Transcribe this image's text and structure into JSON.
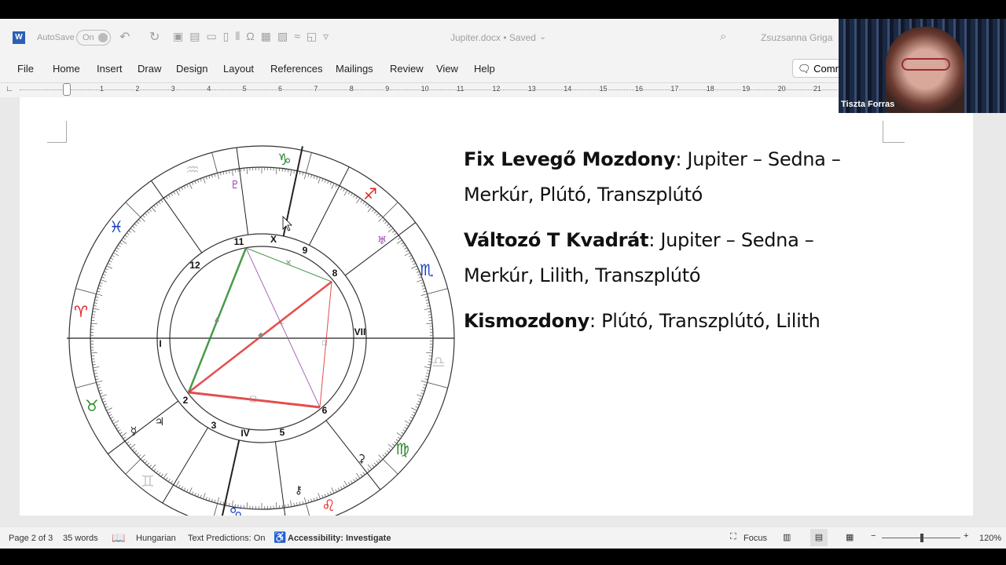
{
  "titlebar": {
    "autosave_label": "AutoSave",
    "autosave_state": "On",
    "document_title": "Jupiter.docx • Saved",
    "user_name": "Zsuzsanna Griga",
    "app_icon": "word-icon"
  },
  "ribbon": {
    "tabs": [
      "File",
      "Home",
      "Insert",
      "Draw",
      "Design",
      "Layout",
      "References",
      "Mailings",
      "Review",
      "View",
      "Help"
    ],
    "comments_label": "Comm"
  },
  "ruler": {
    "marks": [
      "1",
      "2",
      "3",
      "4",
      "5",
      "6",
      "7",
      "8",
      "9",
      "10",
      "11",
      "12",
      "13",
      "14",
      "15",
      "16",
      "17",
      "18",
      "19",
      "20",
      "21"
    ]
  },
  "document": {
    "paragraphs": [
      {
        "bold": "Fix Levegő Mozdony",
        "rest_line1": ": Jupiter – Sedna –",
        "line2": "Merkúr, Plútó, Transzplútó"
      },
      {
        "bold": "Változó T Kvadrát",
        "rest_line1": ": Jupiter – Sedna –",
        "line2": "Merkúr, Lilith, Transzplútó"
      },
      {
        "bold": "Kismozdony",
        "rest_line1": ": Plútó, Transzplútó, Lilith",
        "line2": ""
      }
    ],
    "chart": {
      "house_labels": [
        "11",
        "X",
        "9",
        "8",
        "12",
        "I",
        "VII",
        "2",
        "6",
        "3",
        "IV",
        "5"
      ],
      "zodiac_signs": [
        {
          "glyph": "♑",
          "color": "#2a8a2a"
        },
        {
          "glyph": "♒",
          "color": "#c8c8c8"
        },
        {
          "glyph": "♓",
          "color": "#1a3fbf"
        },
        {
          "glyph": "♈",
          "color": "#e02020"
        },
        {
          "glyph": "♉",
          "color": "#2a8a2a"
        },
        {
          "glyph": "♊",
          "color": "#c8c8c8"
        },
        {
          "glyph": "♋",
          "color": "#1a3fbf"
        },
        {
          "glyph": "♌",
          "color": "#e02020"
        },
        {
          "glyph": "♍",
          "color": "#2a8a2a"
        },
        {
          "glyph": "♎",
          "color": "#c8c8c8"
        },
        {
          "glyph": "♏",
          "color": "#1a3fbf"
        },
        {
          "glyph": "♐",
          "color": "#e02020"
        }
      ],
      "planets": [
        {
          "glyph": "♇",
          "color": "#9a3fb0"
        },
        {
          "glyph": "♅",
          "color": "#9a3fb0"
        },
        {
          "glyph": "⚳",
          "color": "#222"
        },
        {
          "glyph": "☿",
          "color": "#222"
        },
        {
          "glyph": "♃",
          "color": "#222"
        },
        {
          "glyph": "⚷",
          "color": "#222"
        }
      ],
      "aspect_colors": {
        "trine": "#2a8a2a",
        "square": "#e03030",
        "opposition": "#e03030",
        "quincunx": "#9a50b0"
      }
    }
  },
  "status": {
    "page": "Page 2 of 3",
    "words": "35 words",
    "language": "Hungarian",
    "text_predictions": "Text Predictions: On",
    "accessibility": "Accessibility: Investigate",
    "focus": "Focus",
    "zoom": "120%",
    "zoom_level_percent": 120
  },
  "video": {
    "participant_name": "Tiszta Forras"
  }
}
